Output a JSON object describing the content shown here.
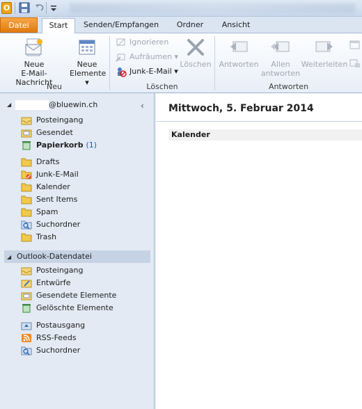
{
  "quick_access": {
    "logo_letter": "O",
    "icons": [
      "outlook-logo-icon",
      "save-icon",
      "undo-icon",
      "customize-dropdown-icon"
    ]
  },
  "tabs": {
    "file": "Datei",
    "items": [
      {
        "label": "Start",
        "active": true
      },
      {
        "label": "Senden/Empfangen",
        "active": false
      },
      {
        "label": "Ordner",
        "active": false
      },
      {
        "label": "Ansicht",
        "active": false
      }
    ]
  },
  "ribbon": {
    "group_new": {
      "label": "Neu",
      "new_email": {
        "line1": "Neue",
        "line2": "E-Mail-Nachricht"
      },
      "new_items": {
        "line1": "Neue",
        "line2": "Elemente ▾"
      }
    },
    "group_delete": {
      "label": "Löschen",
      "ignore": "Ignorieren",
      "cleanup": "Aufräumen ▾",
      "junk": "Junk-E-Mail ▾",
      "delete": "Löschen"
    },
    "group_respond": {
      "label": "Antworten",
      "reply": "Antworten",
      "reply_all": {
        "line1": "Allen",
        "line2": "antworten"
      },
      "forward": "Weiterleiten"
    }
  },
  "nav": {
    "account": {
      "name": "@bluewin.ch"
    },
    "account_folders": [
      {
        "label": "Posteingang",
        "icon": "inbox-icon"
      },
      {
        "label": "Gesendet",
        "icon": "sent-folder-icon"
      },
      {
        "label": "Papierkorb",
        "count": "(1)",
        "bold": true,
        "icon": "trash-icon"
      }
    ],
    "imap_folders": [
      {
        "label": "Drafts",
        "icon": "folder-icon"
      },
      {
        "label": "Junk-E-Mail",
        "icon": "junk-folder-icon"
      },
      {
        "label": "Kalender",
        "icon": "folder-icon"
      },
      {
        "label": "Sent Items",
        "icon": "folder-icon"
      },
      {
        "label": "Spam",
        "icon": "folder-icon"
      },
      {
        "label": "Suchordner",
        "icon": "search-folder-icon"
      },
      {
        "label": "Trash",
        "icon": "folder-icon"
      }
    ],
    "datafile": {
      "label": "Outlook-Datendatei"
    },
    "datafile_folders": [
      {
        "label": "Posteingang",
        "icon": "inbox-icon"
      },
      {
        "label": "Entwürfe",
        "icon": "drafts-icon"
      },
      {
        "label": "Gesendete Elemente",
        "icon": "sent-folder-icon"
      },
      {
        "label": "Gelöschte Elemente",
        "icon": "trash-icon"
      }
    ],
    "other_folders": [
      {
        "label": "Postausgang",
        "icon": "outbox-icon"
      },
      {
        "label": "RSS-Feeds",
        "icon": "rss-icon"
      },
      {
        "label": "Suchordner",
        "icon": "search-folder-icon"
      }
    ]
  },
  "main": {
    "date_title": "Mittwoch, 5. Februar 2014",
    "calendar_header": "Kalender"
  },
  "colors": {
    "file_tab": "#e98a1c",
    "selection": "#c6d3e5",
    "link_count": "#1f5ab5"
  }
}
